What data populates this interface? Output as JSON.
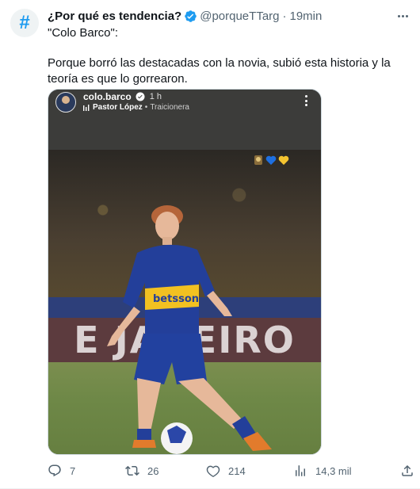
{
  "tweet": {
    "avatar_glyph": "#",
    "display_name": "¿Por qué es tendencia?",
    "handle": "@porqueTTarg",
    "separator": "·",
    "time": "19min",
    "text_heading": "\"Colo Barco\":",
    "text_body": "Porque borró las destacadas con la novia, subió esta historia y la teoría es que lo gorrearon.",
    "verified_color": "#1d9bf0"
  },
  "story": {
    "username": "colo.barco",
    "time": "1 h",
    "artist": "Pastor López",
    "separator": "•",
    "track": "Traicionera",
    "billboard_text": "E JANEIRO",
    "shirt_text": "betsson"
  },
  "actions": {
    "replies": "7",
    "retweets": "26",
    "likes": "214",
    "views": "14,3 mil"
  },
  "icons": [
    "hashtag-icon",
    "verified-icon",
    "more-icon",
    "reply-icon",
    "retweet-icon",
    "like-icon",
    "views-icon",
    "share-icon"
  ]
}
